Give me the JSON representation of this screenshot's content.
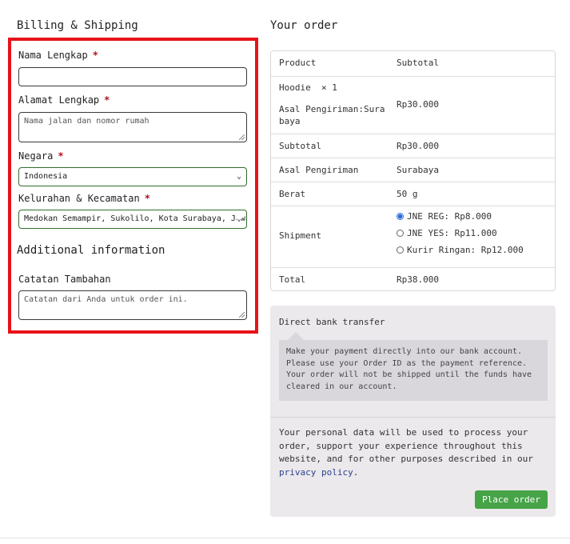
{
  "billing": {
    "title": "Billing & Shipping",
    "fields": {
      "nama": {
        "label": "Nama Lengkap",
        "required": "*",
        "value": ""
      },
      "alamat": {
        "label": "Alamat Lengkap",
        "required": "*",
        "placeholder": "Nama jalan dan nomor rumah"
      },
      "negara": {
        "label": "Negara",
        "required": "*",
        "value": "Indonesia"
      },
      "kelurahan": {
        "label": "Kelurahan & Kecamatan",
        "required": "*",
        "value": "Medokan Semampir, Sukolilo, Kota Surabaya, Jawa Timur"
      }
    },
    "additional_title": "Additional information",
    "catatan": {
      "label": "Catatan Tambahan",
      "placeholder": "Catatan dari Anda untuk order ini."
    }
  },
  "order": {
    "title": "Your order",
    "header": {
      "product": "Product",
      "subtotal": "Subtotal"
    },
    "item": {
      "name": "Hoodie",
      "qty": "× 1",
      "origin_label": "Asal Pengiriman:",
      "origin_value": "Sura baya",
      "price": "Rp30.000"
    },
    "subtotal": {
      "label": "Subtotal",
      "value": "Rp30.000"
    },
    "origin": {
      "label": "Asal Pengiriman",
      "value": "Surabaya"
    },
    "weight": {
      "label": "Berat",
      "value": "50 g"
    },
    "shipment": {
      "label": "Shipment",
      "options": [
        {
          "label": "JNE REG: Rp8.000",
          "selected": true
        },
        {
          "label": "JNE YES: Rp11.000",
          "selected": false
        },
        {
          "label": "Kurir Ringan: Rp12.000",
          "selected": false
        }
      ]
    },
    "total": {
      "label": "Total",
      "value": "Rp38.000"
    }
  },
  "payment": {
    "method": "Direct bank transfer",
    "description": "Make your payment directly into our bank account. Please use your Order ID as the payment reference. Your order will not be shipped until the funds have cleared in our account.",
    "privacy_text": "Your personal data will be used to process your order, support your experience throughout this website, and for other purposes described in our",
    "privacy_link": "privacy policy",
    "privacy_end": ".",
    "button": "Place order"
  },
  "colors": {
    "highlight_border": "#e8121a",
    "button": "#46a447",
    "link": "#2c3f8f",
    "radio_selected": "#2a6ad6"
  },
  "icons": {
    "select_arrow": "chevron-down-icon",
    "radio": "radio-button"
  }
}
